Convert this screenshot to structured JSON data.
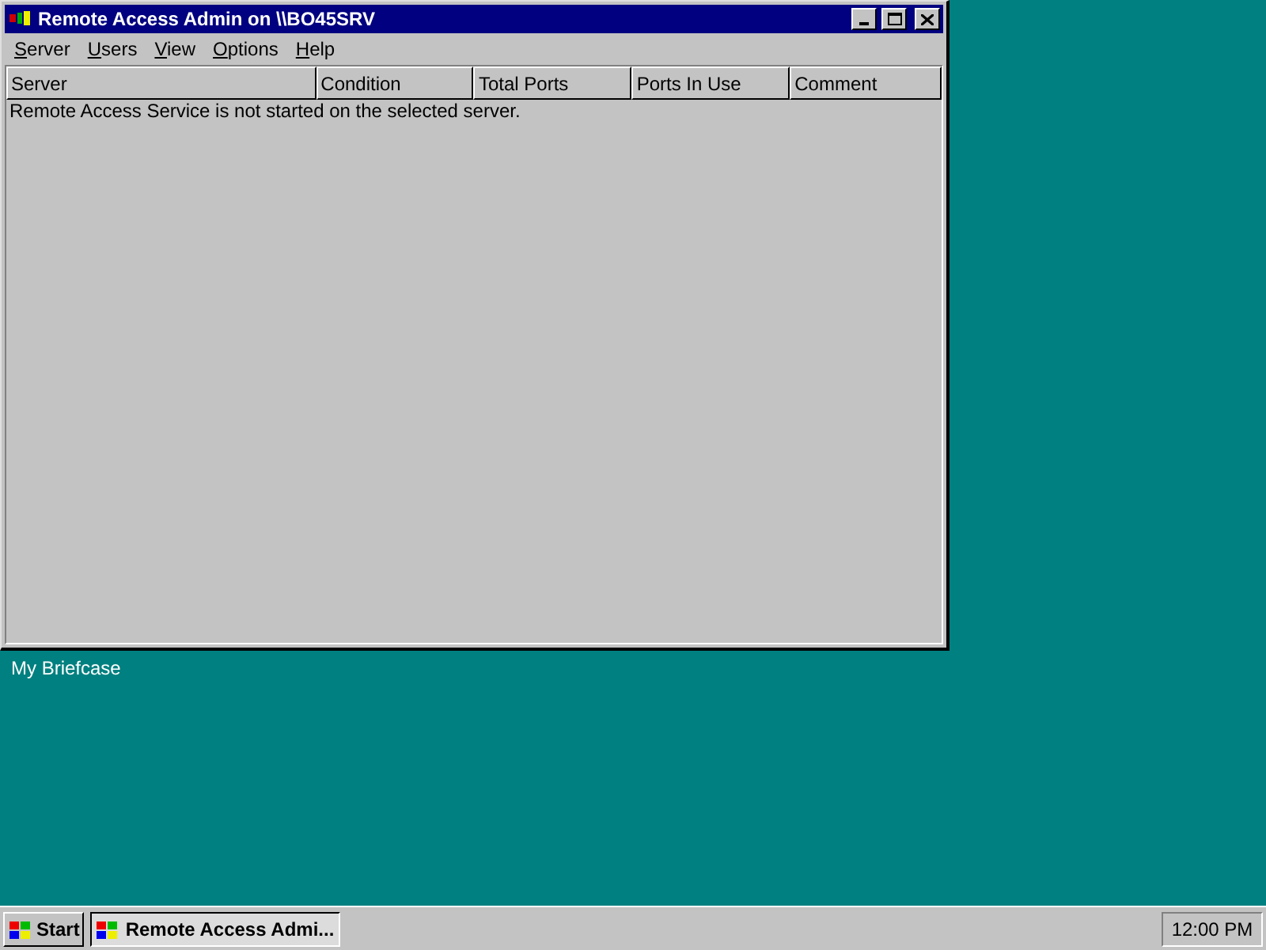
{
  "window": {
    "title": "Remote Access Admin on \\\\BO45SRV"
  },
  "menu": [
    "Server",
    "Users",
    "View",
    "Options",
    "Help"
  ],
  "table": {
    "columns": [
      "Server",
      "Condition",
      "Total Ports",
      "Ports In Use",
      "Comment"
    ],
    "message": "Remote Access Service is not started on the selected server."
  },
  "desktop": {
    "icons": [
      "My Briefcase"
    ]
  },
  "taskbar": {
    "start": "Start",
    "tasks": [
      {
        "label": "Remote Access Admi...",
        "selected": true
      }
    ],
    "clock": "12:00 PM"
  }
}
